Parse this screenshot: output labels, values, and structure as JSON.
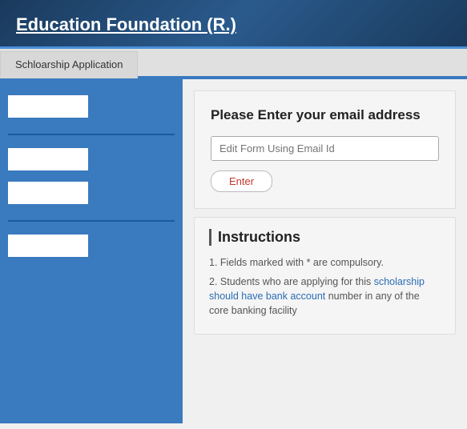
{
  "header": {
    "title": "Education Foundation (R.)"
  },
  "tabs": [
    {
      "label": "Schloarship Application",
      "active": true
    }
  ],
  "sidebar": {
    "inputs": [
      "",
      "",
      "",
      ""
    ],
    "dividers": 2
  },
  "email_box": {
    "title": "Please Enter your email address",
    "input_placeholder": "Edit Form Using Email Id",
    "button_label": "Enter"
  },
  "instructions": {
    "title": "Instructions",
    "items": [
      {
        "num": "1.",
        "text": "Fields marked with * are compulsory."
      },
      {
        "num": "2.",
        "text_before": "Students who are applying for this",
        "text_link": " scholarship should have bank account",
        "text_after": " number in any of the core banking facility"
      }
    ]
  }
}
